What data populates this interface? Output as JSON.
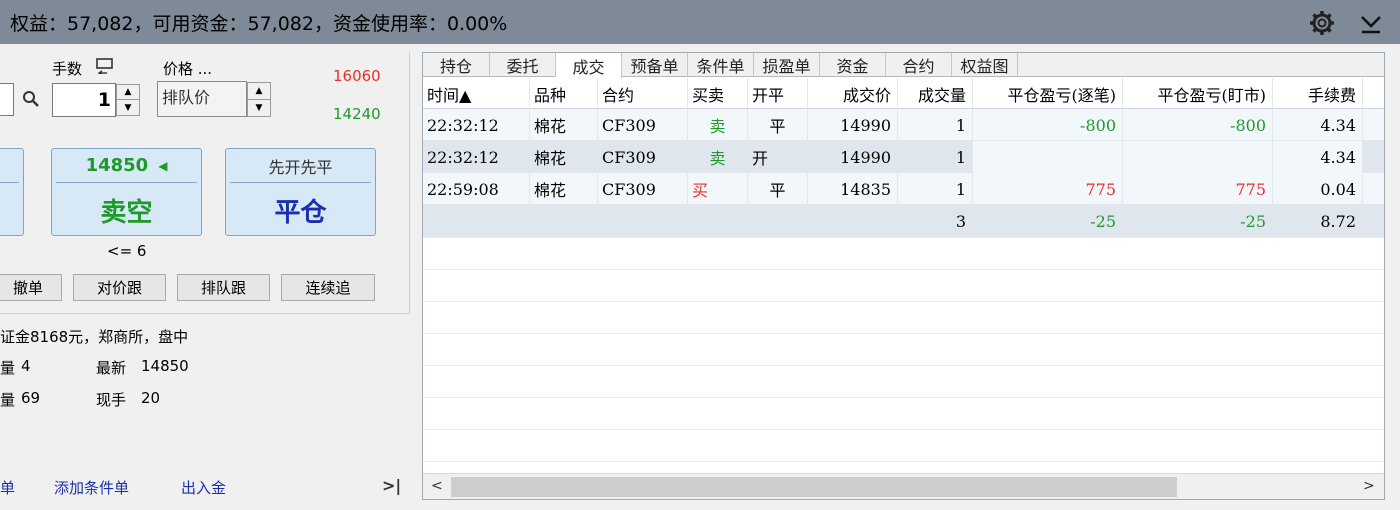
{
  "header": {
    "summary": "权益：57,082，可用资金：57,082，资金使用率：0.00%",
    "settings_icon": "gear-icon",
    "collapse_icon": "chevron-down-icon"
  },
  "order": {
    "lots_label": "手数",
    "lots_value": "1",
    "price_label": "价格 ...",
    "price_mode": "排队价",
    "upper_limit": "16060",
    "lower_limit": "14240",
    "sell_price": "14850",
    "sell_label": "卖空",
    "close_top": "先开先平",
    "close_label": "平仓",
    "max_lots": "<= 6",
    "buttons": [
      "撤单",
      "对价跟",
      "排队跟",
      "连续追"
    ]
  },
  "info": {
    "line1": "证金8168元，郑商所，盘中",
    "r2a_label": "量",
    "r2a_value": "4",
    "r2b_label": "最新",
    "r2b_value": "14850",
    "r3a_label": "量",
    "r3a_value": "69",
    "r3b_label": "现手",
    "r3b_value": "20"
  },
  "links": {
    "l1": "单",
    "l2": "添加条件单",
    "l3": "出入金",
    "collapse": ">|"
  },
  "tabs": [
    "持仓",
    "委托",
    "成交",
    "预备单",
    "条件单",
    "损盈单",
    "资金",
    "合约",
    "权益图"
  ],
  "active_tab": "成交",
  "table": {
    "columns": [
      "时间▲",
      "品种",
      "合约",
      "买卖",
      "开平",
      "成交价",
      "成交量",
      "平仓盈亏(逐笔)",
      "平仓盈亏(盯市)",
      "手续费"
    ],
    "rows": [
      {
        "time": "22:32:12",
        "product": "棉花",
        "contract": "CF309",
        "side": "卖",
        "oc": "平",
        "price": "14990",
        "qty": "1",
        "pnl1": "-800",
        "pnl2": "-800",
        "fee": "4.34"
      },
      {
        "time": "22:32:12",
        "product": "棉花",
        "contract": "CF309",
        "side": "卖",
        "oc": "开",
        "price": "14990",
        "qty": "1",
        "pnl1": "",
        "pnl2": "",
        "fee": "4.34"
      },
      {
        "time": "22:59:08",
        "product": "棉花",
        "contract": "CF309",
        "side": "买",
        "oc": "平",
        "price": "14835",
        "qty": "1",
        "pnl1": "775",
        "pnl2": "775",
        "fee": "0.04"
      }
    ],
    "total": {
      "qty": "3",
      "pnl1": "-25",
      "pnl2": "-25",
      "fee": "8.72"
    }
  },
  "colors": {
    "profit": "#e8302a",
    "loss": "#1e9a28",
    "topbar": "#7f8a98"
  }
}
